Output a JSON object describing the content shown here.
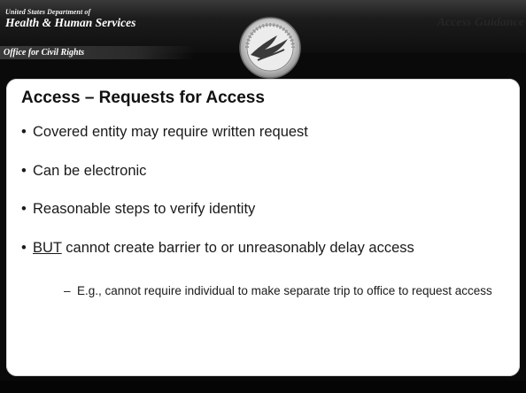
{
  "header": {
    "dept_line1": "United States Department of",
    "dept_line2": "Health & Human Services",
    "office": "Office for Civil Rights",
    "section_title": "Access Guidance"
  },
  "slide": {
    "title": "Access – Requests for Access",
    "bullet_glyph": "•",
    "bullets": [
      {
        "text": "Covered entity may require written request"
      },
      {
        "text": "Can be electronic"
      },
      {
        "text": "Reasonable steps to verify identity"
      },
      {
        "emphasis": "BUT",
        "text": " cannot create barrier to or unreasonably delay access"
      }
    ],
    "sub_dash": "–",
    "sub_bullets": [
      {
        "text": "E.g., cannot require individual to make separate trip to office to request access"
      }
    ]
  },
  "colors": {
    "background": "#0a0a0a",
    "panel": "#ffffff",
    "header_text": "#ffffff",
    "body_text": "#1a1a1a"
  },
  "icons": {
    "seal": "hhs-eagle-seal-icon"
  }
}
